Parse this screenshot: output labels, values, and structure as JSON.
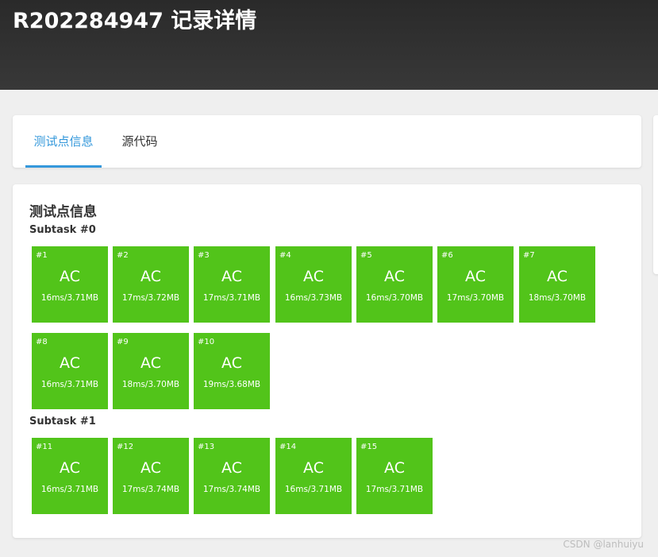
{
  "header": {
    "title": "R202284947 记录详情"
  },
  "tabs": [
    {
      "label": "测试点信息",
      "active": true
    },
    {
      "label": "源代码",
      "active": false
    }
  ],
  "section": {
    "title": "测试点信息"
  },
  "subtasks": [
    {
      "label": "Subtask #0",
      "cases": [
        {
          "id": "#1",
          "status": "AC",
          "stats": "16ms/3.71MB"
        },
        {
          "id": "#2",
          "status": "AC",
          "stats": "17ms/3.72MB"
        },
        {
          "id": "#3",
          "status": "AC",
          "stats": "17ms/3.71MB"
        },
        {
          "id": "#4",
          "status": "AC",
          "stats": "16ms/3.73MB"
        },
        {
          "id": "#5",
          "status": "AC",
          "stats": "16ms/3.70MB"
        },
        {
          "id": "#6",
          "status": "AC",
          "stats": "17ms/3.70MB"
        },
        {
          "id": "#7",
          "status": "AC",
          "stats": "18ms/3.70MB"
        },
        {
          "id": "#8",
          "status": "AC",
          "stats": "16ms/3.71MB"
        },
        {
          "id": "#9",
          "status": "AC",
          "stats": "18ms/3.70MB"
        },
        {
          "id": "#10",
          "status": "AC",
          "stats": "19ms/3.68MB"
        }
      ]
    },
    {
      "label": "Subtask #1",
      "cases": [
        {
          "id": "#11",
          "status": "AC",
          "stats": "16ms/3.71MB"
        },
        {
          "id": "#12",
          "status": "AC",
          "stats": "17ms/3.74MB"
        },
        {
          "id": "#13",
          "status": "AC",
          "stats": "17ms/3.74MB"
        },
        {
          "id": "#14",
          "status": "AC",
          "stats": "16ms/3.71MB"
        },
        {
          "id": "#15",
          "status": "AC",
          "stats": "17ms/3.71MB"
        }
      ]
    }
  ],
  "watermark": "CSDN @lanhuiyu",
  "colors": {
    "accent": "#3498db",
    "ac_green": "#52c41a",
    "header_bg": "#2f2f2f"
  }
}
